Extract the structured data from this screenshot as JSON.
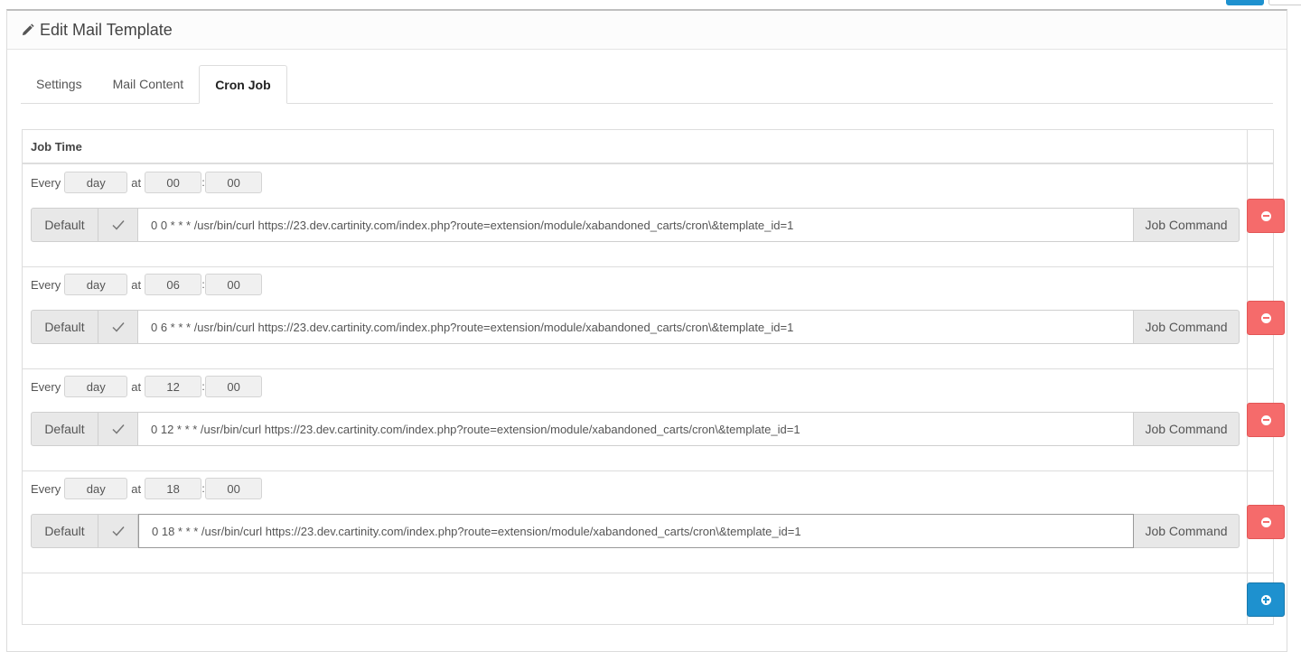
{
  "page": {
    "title": "Edit Mail Template",
    "title_icon": "pencil-icon"
  },
  "tabs": [
    {
      "label": "Settings",
      "active": false
    },
    {
      "label": "Mail Content",
      "active": false
    },
    {
      "label": "Cron Job",
      "active": true
    }
  ],
  "table": {
    "header": "Job Time"
  },
  "jobs": [
    {
      "every_label": "Every",
      "period": "day",
      "at_label": "at",
      "hour": "00",
      "separator": ":",
      "minute": "00",
      "default_label": "Default",
      "command": "0 0 * * * /usr/bin/curl https://23.dev.cartinity.com/index.php?route=extension/module/xabandoned_carts/cron\\&template_id=1",
      "addon_label": "Job Command"
    },
    {
      "every_label": "Every",
      "period": "day",
      "at_label": "at",
      "hour": "06",
      "separator": ":",
      "minute": "00",
      "default_label": "Default",
      "command": "0 6 * * * /usr/bin/curl https://23.dev.cartinity.com/index.php?route=extension/module/xabandoned_carts/cron\\&template_id=1",
      "addon_label": "Job Command"
    },
    {
      "every_label": "Every",
      "period": "day",
      "at_label": "at",
      "hour": "12",
      "separator": ":",
      "minute": "00",
      "default_label": "Default",
      "command": "0 12 * * * /usr/bin/curl https://23.dev.cartinity.com/index.php?route=extension/module/xabandoned_carts/cron\\&template_id=1",
      "addon_label": "Job Command"
    },
    {
      "every_label": "Every",
      "period": "day",
      "at_label": "at",
      "hour": "18",
      "separator": ":",
      "minute": "00",
      "default_label": "Default",
      "command": "0 18 * * * /usr/bin/curl https://23.dev.cartinity.com/index.php?route=extension/module/xabandoned_carts/cron\\&template_id=1",
      "addon_label": "Job Command"
    }
  ],
  "colors": {
    "danger": "#f56b6b",
    "primary": "#1e91cf"
  },
  "icons": {
    "remove": "minus-circle-icon",
    "add": "plus-circle-icon",
    "check": "check-icon"
  }
}
